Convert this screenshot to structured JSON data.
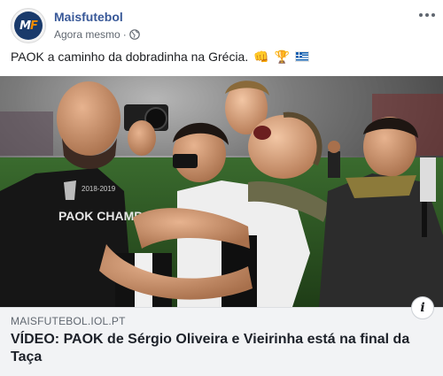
{
  "post": {
    "page_name": "Maisfutebol",
    "timestamp": "Agora mesmo",
    "separator": "·",
    "caption": "PAOK a caminho da dobradinha na Grécia.",
    "emojis": [
      "👊",
      "🏆"
    ],
    "avatar_letters": {
      "m": "M",
      "f": "F"
    },
    "icons": {
      "privacy": "globe-icon",
      "menu": "more-options-icon",
      "info": "info-icon",
      "flag": "greece-flag-icon"
    }
  },
  "photo": {
    "jersey_text": "PAOK CHAMP",
    "jersey_year": "2018-2019"
  },
  "link": {
    "domain": "MAISFUTEBOL.IOL.PT",
    "headline": "VÍDEO: PAOK de Sérgio Oliveira e Vieirinha está na final da Taça",
    "info_label": "i"
  },
  "colors": {
    "page_name": "#385898",
    "meta_text": "#606770",
    "link_bg": "#f2f3f5",
    "avatar_bg": "#1a3a6b",
    "avatar_accent": "#f28c00"
  }
}
